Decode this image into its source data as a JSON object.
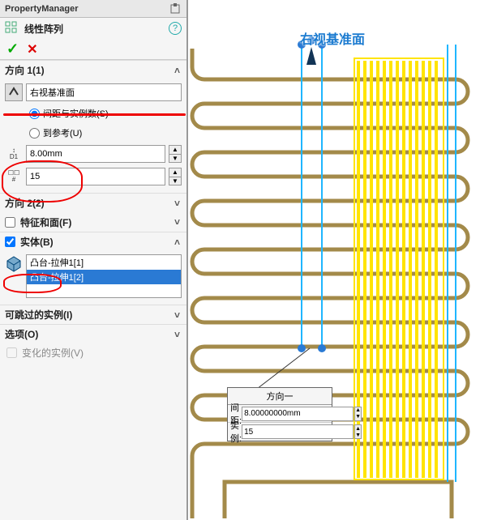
{
  "pm": {
    "title": "PropertyManager"
  },
  "cmd": {
    "label": "线性阵列"
  },
  "dir1": {
    "header": "方向 1(1)",
    "ref_value": "右视基准面",
    "radio1": "间距与实例数(S)",
    "radio2": "到参考(U)",
    "spacing": "8.00mm",
    "count": "15"
  },
  "dir2": {
    "header": "方向 2(2)"
  },
  "feat": {
    "header": "特征和面(F)"
  },
  "body": {
    "header": "实体(B)",
    "items": [
      "凸台-拉伸1[1]",
      "凸台-拉伸1[2]"
    ]
  },
  "skip": {
    "header": "可跳过的实例(I)"
  },
  "opts": {
    "header": "选项(O)"
  },
  "vary": {
    "label": "变化的实例(V)"
  },
  "viewport": {
    "ref_label": "右视基准面"
  },
  "float": {
    "title": "方向一",
    "row1_label": "间距:",
    "row1_value": "8.00000000mm",
    "row2_label": "实例:",
    "row2_value": "15"
  }
}
